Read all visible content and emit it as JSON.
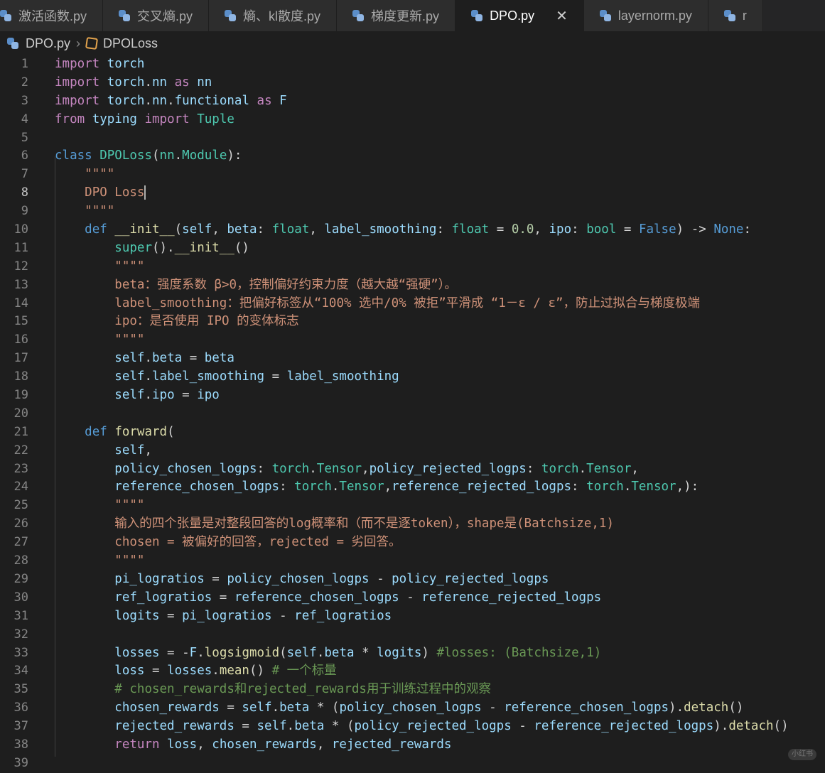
{
  "tabs": [
    {
      "label": "激活函数.py",
      "active": false
    },
    {
      "label": "交叉熵.py",
      "active": false
    },
    {
      "label": "熵、kl散度.py",
      "active": false
    },
    {
      "label": "梯度更新.py",
      "active": false
    },
    {
      "label": "DPO.py",
      "active": true
    },
    {
      "label": "layernorm.py",
      "active": false
    },
    {
      "label": "r",
      "active": false
    }
  ],
  "breadcrumb": {
    "file": "DPO.py",
    "symbol": "DPOLoss"
  },
  "current_line": 8,
  "watermark": "小红书",
  "colors": {
    "keyword": "#c586c0",
    "keyword_blue": "#569cd6",
    "function": "#dcdcaa",
    "variable": "#9cdcfe",
    "type": "#4ec9b0",
    "string": "#ce9178",
    "number": "#b5cea8",
    "comment": "#6a9955",
    "default": "#d4d4d4"
  },
  "lines": [
    [
      [
        "kw",
        "import"
      ],
      [
        "d",
        " "
      ],
      [
        "v",
        "torch"
      ]
    ],
    [
      [
        "kw",
        "import"
      ],
      [
        "d",
        " "
      ],
      [
        "v",
        "torch"
      ],
      [
        "d",
        "."
      ],
      [
        "v",
        "nn"
      ],
      [
        "d",
        " "
      ],
      [
        "kw",
        "as"
      ],
      [
        "d",
        " "
      ],
      [
        "v",
        "nn"
      ]
    ],
    [
      [
        "kw",
        "import"
      ],
      [
        "d",
        " "
      ],
      [
        "v",
        "torch"
      ],
      [
        "d",
        "."
      ],
      [
        "v",
        "nn"
      ],
      [
        "d",
        "."
      ],
      [
        "v",
        "functional"
      ],
      [
        "d",
        " "
      ],
      [
        "kw",
        "as"
      ],
      [
        "d",
        " "
      ],
      [
        "v",
        "F"
      ]
    ],
    [
      [
        "kw",
        "from"
      ],
      [
        "d",
        " "
      ],
      [
        "v",
        "typing"
      ],
      [
        "d",
        " "
      ],
      [
        "kw",
        "import"
      ],
      [
        "d",
        " "
      ],
      [
        "t",
        "Tuple"
      ]
    ],
    [],
    [
      [
        "kb",
        "class"
      ],
      [
        "d",
        " "
      ],
      [
        "t",
        "DPOLoss"
      ],
      [
        "d",
        "("
      ],
      [
        "t",
        "nn"
      ],
      [
        "d",
        "."
      ],
      [
        "t",
        "Module"
      ],
      [
        "d",
        "):"
      ]
    ],
    [
      [
        "d",
        "    "
      ],
      [
        "s",
        "\"\"\"\""
      ]
    ],
    [
      [
        "d",
        "    "
      ],
      [
        "s",
        "DPO Loss"
      ]
    ],
    [
      [
        "d",
        "    "
      ],
      [
        "s",
        "\"\"\"\""
      ]
    ],
    [
      [
        "d",
        "    "
      ],
      [
        "kb",
        "def"
      ],
      [
        "d",
        " "
      ],
      [
        "f",
        "__init__"
      ],
      [
        "d",
        "("
      ],
      [
        "v",
        "self"
      ],
      [
        "d",
        ", "
      ],
      [
        "v",
        "beta"
      ],
      [
        "d",
        ": "
      ],
      [
        "t",
        "float"
      ],
      [
        "d",
        ", "
      ],
      [
        "v",
        "label_smoothing"
      ],
      [
        "d",
        ": "
      ],
      [
        "t",
        "float"
      ],
      [
        "d",
        " = "
      ],
      [
        "n",
        "0.0"
      ],
      [
        "d",
        ", "
      ],
      [
        "v",
        "ipo"
      ],
      [
        "d",
        ": "
      ],
      [
        "t",
        "bool"
      ],
      [
        "d",
        " = "
      ],
      [
        "kb",
        "False"
      ],
      [
        "d",
        ") -> "
      ],
      [
        "kb",
        "None"
      ],
      [
        "d",
        ":"
      ]
    ],
    [
      [
        "d",
        "        "
      ],
      [
        "t",
        "super"
      ],
      [
        "d",
        "()."
      ],
      [
        "f",
        "__init__"
      ],
      [
        "d",
        "()"
      ]
    ],
    [
      [
        "d",
        "        "
      ],
      [
        "s",
        "\"\"\"\""
      ]
    ],
    [
      [
        "d",
        "        "
      ],
      [
        "s",
        "beta：强度系数 β>0，控制偏好约束力度（越大越“强硬”）。"
      ]
    ],
    [
      [
        "d",
        "        "
      ],
      [
        "s",
        "label_smoothing：把偏好标签从“100% 选中/0% 被拒”平滑成 “1－ε / ε”，防止过拟合与梯度极端"
      ]
    ],
    [
      [
        "d",
        "        "
      ],
      [
        "s",
        "ipo：是否使用 IPO 的变体标志"
      ]
    ],
    [
      [
        "d",
        "        "
      ],
      [
        "s",
        "\"\"\"\""
      ]
    ],
    [
      [
        "d",
        "        "
      ],
      [
        "v",
        "self"
      ],
      [
        "d",
        "."
      ],
      [
        "v",
        "beta"
      ],
      [
        "d",
        " = "
      ],
      [
        "v",
        "beta"
      ]
    ],
    [
      [
        "d",
        "        "
      ],
      [
        "v",
        "self"
      ],
      [
        "d",
        "."
      ],
      [
        "v",
        "label_smoothing"
      ],
      [
        "d",
        " = "
      ],
      [
        "v",
        "label_smoothing"
      ]
    ],
    [
      [
        "d",
        "        "
      ],
      [
        "v",
        "self"
      ],
      [
        "d",
        "."
      ],
      [
        "v",
        "ipo"
      ],
      [
        "d",
        " = "
      ],
      [
        "v",
        "ipo"
      ]
    ],
    [],
    [
      [
        "d",
        "    "
      ],
      [
        "kb",
        "def"
      ],
      [
        "d",
        " "
      ],
      [
        "f",
        "forward"
      ],
      [
        "d",
        "("
      ]
    ],
    [
      [
        "d",
        "        "
      ],
      [
        "v",
        "self"
      ],
      [
        "d",
        ","
      ]
    ],
    [
      [
        "d",
        "        "
      ],
      [
        "v",
        "policy_chosen_logps"
      ],
      [
        "d",
        ": "
      ],
      [
        "t",
        "torch"
      ],
      [
        "d",
        "."
      ],
      [
        "t",
        "Tensor"
      ],
      [
        "d",
        ","
      ],
      [
        "v",
        "policy_rejected_logps"
      ],
      [
        "d",
        ": "
      ],
      [
        "t",
        "torch"
      ],
      [
        "d",
        "."
      ],
      [
        "t",
        "Tensor"
      ],
      [
        "d",
        ","
      ]
    ],
    [
      [
        "d",
        "        "
      ],
      [
        "v",
        "reference_chosen_logps"
      ],
      [
        "d",
        ": "
      ],
      [
        "t",
        "torch"
      ],
      [
        "d",
        "."
      ],
      [
        "t",
        "Tensor"
      ],
      [
        "d",
        ","
      ],
      [
        "v",
        "reference_rejected_logps"
      ],
      [
        "d",
        ": "
      ],
      [
        "t",
        "torch"
      ],
      [
        "d",
        "."
      ],
      [
        "t",
        "Tensor"
      ],
      [
        "d",
        ",):"
      ]
    ],
    [
      [
        "d",
        "        "
      ],
      [
        "s",
        "\"\"\"\""
      ]
    ],
    [
      [
        "d",
        "        "
      ],
      [
        "s",
        "输入的四个张量是对整段回答的log概率和（而不是逐token），shape是(Batchsize,1)"
      ]
    ],
    [
      [
        "d",
        "        "
      ],
      [
        "s",
        "chosen = 被偏好的回答，rejected = 劣回答。"
      ]
    ],
    [
      [
        "d",
        "        "
      ],
      [
        "s",
        "\"\"\"\""
      ]
    ],
    [
      [
        "d",
        "        "
      ],
      [
        "v",
        "pi_logratios"
      ],
      [
        "d",
        " = "
      ],
      [
        "v",
        "policy_chosen_logps"
      ],
      [
        "d",
        " - "
      ],
      [
        "v",
        "policy_rejected_logps"
      ]
    ],
    [
      [
        "d",
        "        "
      ],
      [
        "v",
        "ref_logratios"
      ],
      [
        "d",
        " = "
      ],
      [
        "v",
        "reference_chosen_logps"
      ],
      [
        "d",
        " - "
      ],
      [
        "v",
        "reference_rejected_logps"
      ]
    ],
    [
      [
        "d",
        "        "
      ],
      [
        "v",
        "logits"
      ],
      [
        "d",
        " = "
      ],
      [
        "v",
        "pi_logratios"
      ],
      [
        "d",
        " - "
      ],
      [
        "v",
        "ref_logratios"
      ]
    ],
    [],
    [
      [
        "d",
        "        "
      ],
      [
        "v",
        "losses"
      ],
      [
        "d",
        " = -"
      ],
      [
        "v",
        "F"
      ],
      [
        "d",
        "."
      ],
      [
        "f",
        "logsigmoid"
      ],
      [
        "d",
        "("
      ],
      [
        "v",
        "self"
      ],
      [
        "d",
        "."
      ],
      [
        "v",
        "beta"
      ],
      [
        "d",
        " * "
      ],
      [
        "v",
        "logits"
      ],
      [
        "d",
        ") "
      ],
      [
        "c",
        "#losses: (Batchsize,1)"
      ]
    ],
    [
      [
        "d",
        "        "
      ],
      [
        "v",
        "loss"
      ],
      [
        "d",
        " = "
      ],
      [
        "v",
        "losses"
      ],
      [
        "d",
        "."
      ],
      [
        "f",
        "mean"
      ],
      [
        "d",
        "() "
      ],
      [
        "c",
        "# 一个标量"
      ]
    ],
    [
      [
        "d",
        "        "
      ],
      [
        "c",
        "# chosen_rewards和rejected_rewards用于训练过程中的观察"
      ]
    ],
    [
      [
        "d",
        "        "
      ],
      [
        "v",
        "chosen_rewards"
      ],
      [
        "d",
        " = "
      ],
      [
        "v",
        "self"
      ],
      [
        "d",
        "."
      ],
      [
        "v",
        "beta"
      ],
      [
        "d",
        " * ("
      ],
      [
        "v",
        "policy_chosen_logps"
      ],
      [
        "d",
        " - "
      ],
      [
        "v",
        "reference_chosen_logps"
      ],
      [
        "d",
        ")."
      ],
      [
        "f",
        "detach"
      ],
      [
        "d",
        "()"
      ]
    ],
    [
      [
        "d",
        "        "
      ],
      [
        "v",
        "rejected_rewards"
      ],
      [
        "d",
        " = "
      ],
      [
        "v",
        "self"
      ],
      [
        "d",
        "."
      ],
      [
        "v",
        "beta"
      ],
      [
        "d",
        " * ("
      ],
      [
        "v",
        "policy_rejected_logps"
      ],
      [
        "d",
        " - "
      ],
      [
        "v",
        "reference_rejected_logps"
      ],
      [
        "d",
        ")."
      ],
      [
        "f",
        "detach"
      ],
      [
        "d",
        "()"
      ]
    ],
    [
      [
        "d",
        "        "
      ],
      [
        "kw",
        "return"
      ],
      [
        "d",
        " "
      ],
      [
        "v",
        "loss"
      ],
      [
        "d",
        ", "
      ],
      [
        "v",
        "chosen_rewards"
      ],
      [
        "d",
        ", "
      ],
      [
        "v",
        "rejected_rewards"
      ]
    ],
    []
  ]
}
